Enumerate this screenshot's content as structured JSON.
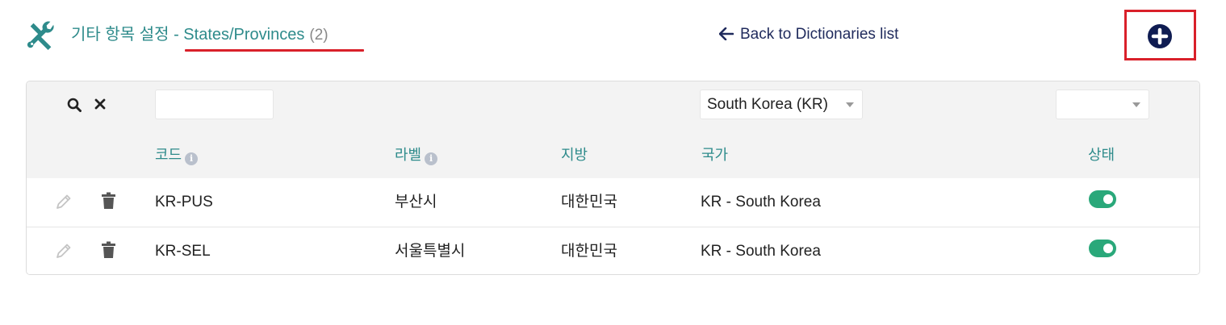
{
  "header": {
    "icon": "tools-icon",
    "title_prefix": "기타 항목 설정 - ",
    "title_link": "States/Provinces",
    "count": "(2)",
    "back_link": "Back to Dictionaries list",
    "add_icon": "plus-circle-icon",
    "accent_color": "#2e8b8b",
    "highlight_color": "#d9202a"
  },
  "filters": {
    "code_filter_value": "",
    "country_filter_value": "South Korea (KR)",
    "status_filter_value": ""
  },
  "columns": {
    "code": "코드",
    "label": "라벨",
    "region": "지방",
    "country": "국가",
    "status": "상태"
  },
  "rows": [
    {
      "code": "KR-PUS",
      "label": "부산시",
      "region": "대한민국",
      "country": "KR - South Korea",
      "active": true
    },
    {
      "code": "KR-SEL",
      "label": "서울특별시",
      "region": "대한민국",
      "country": "KR - South Korea",
      "active": true
    }
  ]
}
